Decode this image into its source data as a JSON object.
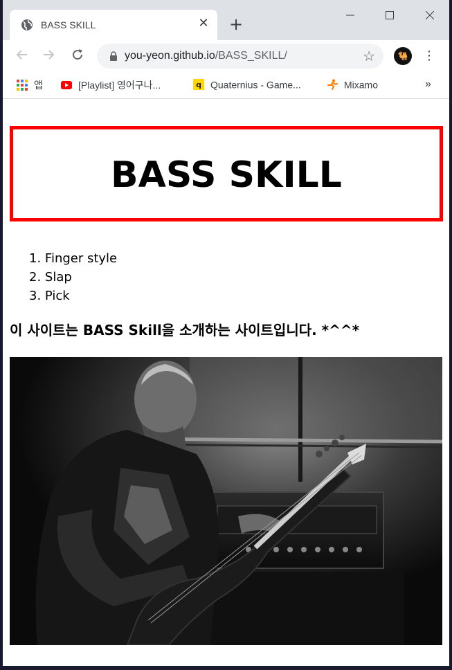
{
  "browser": {
    "tab_title": "BASS SKILL",
    "url_host": "you-yeon.github.io",
    "url_path": "/BASS_SKILL/",
    "bookmarks": [
      {
        "label": "앱",
        "icon": "apps-grid-icon"
      },
      {
        "label": "[Playlist] 영어구나...",
        "icon": "youtube-icon"
      },
      {
        "label": "Quaternius - Game...",
        "icon": "quaternius-icon"
      },
      {
        "label": "Mixamo",
        "icon": "mixamo-runner-icon"
      }
    ],
    "more_label": "»"
  },
  "page": {
    "title": "BASS SKILL",
    "skills": [
      "1. Finger style",
      "2. Slap",
      "3. Pick"
    ],
    "intro": "이 사이트는 BASS Skill을 소개하는 사이트입니다. *^^*"
  },
  "colors": {
    "title_border": "#ff0000",
    "tabstrip": "#dee1e6",
    "omnibox": "#f1f3f4"
  }
}
